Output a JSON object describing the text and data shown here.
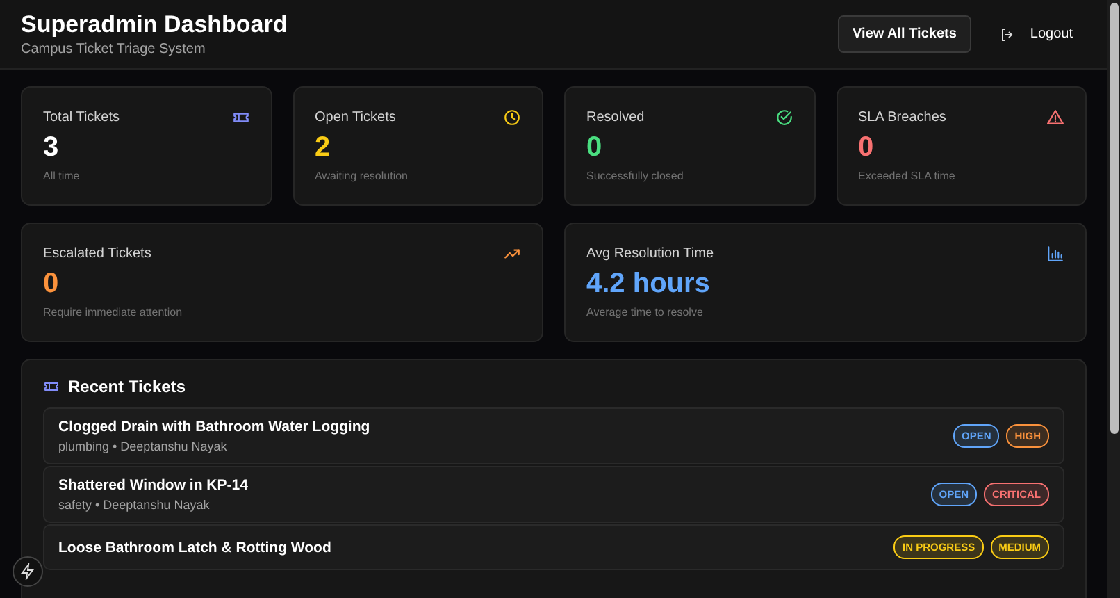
{
  "header": {
    "title": "Superadmin Dashboard",
    "subtitle": "Campus Ticket Triage System",
    "buttons": [
      {
        "kind": "primary",
        "label": "View All Tickets"
      },
      {
        "kind": "logout",
        "label": "Logout"
      }
    ]
  },
  "stats": [
    {
      "label": "Total Tickets",
      "value": "3",
      "note": "All time",
      "color": "#ffffff"
    },
    {
      "label": "Open Tickets",
      "value": "2",
      "note": "Awaiting resolution",
      "color": "#facc15"
    },
    {
      "label": "Resolved",
      "value": "0",
      "note": "Successfully closed",
      "color": "#4ade80"
    },
    {
      "label": "SLA Breaches",
      "value": "0",
      "note": "Exceeded SLA time",
      "color": "#f87171"
    },
    {
      "label": "Escalated Tickets",
      "value": "0",
      "note": "Require immediate attention",
      "color": "#fb923c"
    },
    {
      "label": "Avg Resolution Time",
      "value": "4.2 hours",
      "note": "Average time to resolve",
      "color": "#60a5fa"
    }
  ],
  "recent": {
    "title": "Recent Tickets",
    "tickets": [
      {
        "title": "Clogged Drain with Bathroom Water Logging",
        "meta": "plumbing • Deeptanshu Nayak",
        "badges": [
          {
            "label": "OPEN",
            "color": "#60a5fa"
          },
          {
            "label": "HIGH",
            "color": "#fb923c"
          }
        ]
      },
      {
        "title": "Shattered Window in KP-14",
        "meta": "safety • Deeptanshu Nayak",
        "badges": [
          {
            "label": "OPEN",
            "color": "#60a5fa"
          },
          {
            "label": "CRITICAL",
            "color": "#f87171"
          }
        ]
      },
      {
        "title": "Loose Bathroom Latch & Rotting Wood",
        "badges": [
          {
            "label": "IN PROGRESS",
            "color": "#facc15"
          },
          {
            "label": "MEDIUM",
            "color": "#facc15"
          }
        ]
      }
    ]
  }
}
